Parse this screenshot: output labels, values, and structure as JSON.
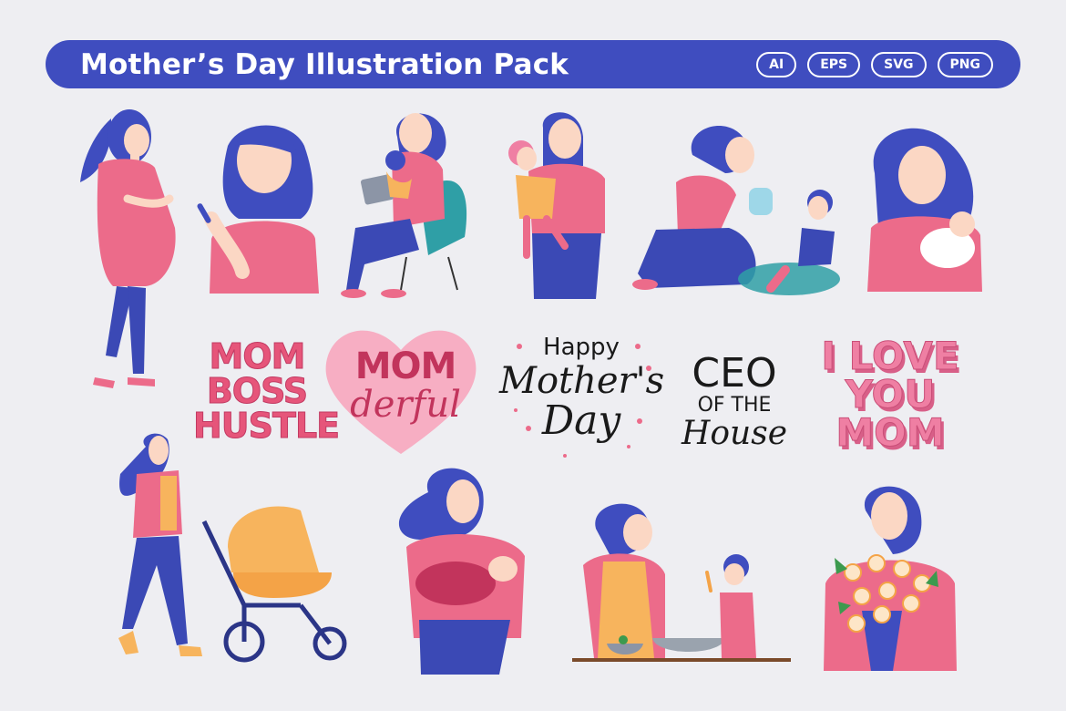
{
  "header": {
    "title": "Mother’s Day Illustration Pack",
    "formats": [
      "AI",
      "EPS",
      "SVG",
      "PNG"
    ]
  },
  "lettering": {
    "mom_boss": [
      "MOM",
      "BOSS",
      "HUSTLE"
    ],
    "momderful": [
      "MOM",
      "derful"
    ],
    "happy_mothers_day": [
      "Happy",
      "Mother's",
      "Day"
    ],
    "ceo": [
      "CEO",
      "OF THE",
      "House"
    ],
    "i_love_you_mom": [
      "I LOVE",
      "YOU",
      "MOM"
    ]
  },
  "colors": {
    "banner": "#3f4dbf",
    "background": "#eeeef2",
    "hair": "#3f4dbf",
    "shirt_pink": "#ec6b8a",
    "pants_blue": "#3b49b5",
    "skin": "#fbd7c4",
    "heart": "#f7aec3",
    "teal_chair": "#2f9fa6",
    "stroller_orange": "#f7b45d"
  }
}
